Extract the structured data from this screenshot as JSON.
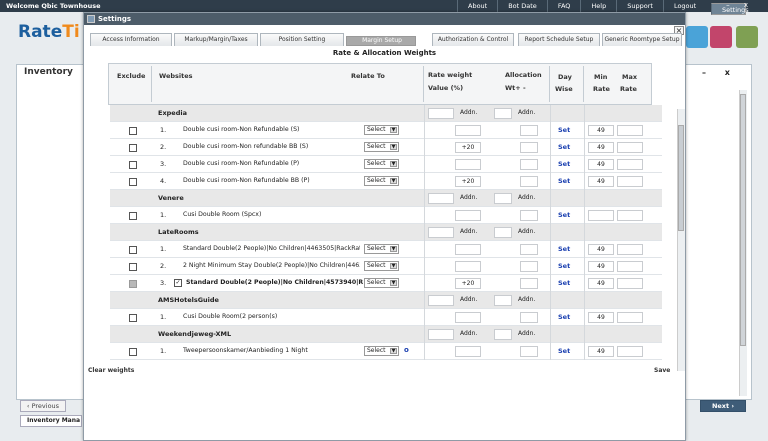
{
  "topbar": {
    "welcome": "Welcome Qbic Townhouse",
    "nav": [
      "About",
      "Settings",
      "Bot Date",
      "FAQ",
      "Help",
      "Support",
      "Logout"
    ],
    "win": "– x"
  },
  "logo": {
    "a": "Rate",
    "b": "Ti"
  },
  "bg": {
    "title": "Inventory",
    "prev": "‹ Previous",
    "next": "Next ›",
    "bottom_tab": "Inventory Mana",
    "ctrl": "– x"
  },
  "dialog": {
    "title": "Settings",
    "close": "×",
    "tabs": [
      "Access Information",
      "Markup/Margin/Taxes",
      "Position Setting",
      "Margin Setup",
      "Authorization & Control",
      "Report Schedule Setup",
      "Generic Roomtype Setup"
    ],
    "active_tab": 3,
    "subtitle": "Rate & Allocation Weights",
    "headers": {
      "exclude": "Exclude",
      "websites": "Websites",
      "relate": "Relate To",
      "rw1": "Rate weight",
      "rw2": "Value (%)",
      "al1": "Allocation",
      "al2": "Wt+ -",
      "day1": "Day",
      "day2": "Wise",
      "min1": "Min",
      "min2": "Rate",
      "max1": "Max",
      "max2": "Rate"
    },
    "addn": "Addn.",
    "set": "Set",
    "select": "Select",
    "groups": [
      {
        "name": "Expedia",
        "rows": [
          {
            "n": "1.",
            "site": "Double cusi room-Non Refundable (S)",
            "rw": "",
            "min": "49"
          },
          {
            "n": "2.",
            "site": "Double cusi room-Non refundable BB (S)",
            "rw": "+20",
            "min": "49"
          },
          {
            "n": "3.",
            "site": "Double cusi room-Non Refundable (P)",
            "rw": "",
            "min": "49"
          },
          {
            "n": "4.",
            "site": "Double cusi room-Non Refundable BB (P)",
            "rw": "+20",
            "min": "49"
          }
        ]
      },
      {
        "name": "Venere",
        "rows": [
          {
            "n": "1.",
            "site": "Cusi Double Room (Spcx)",
            "rw": "",
            "min": "",
            "nosel": true
          }
        ]
      },
      {
        "name": "LateRooms",
        "rows": [
          {
            "n": "1.",
            "site": "Standard Double(2 People)|No Children|4463505|RackRate(...",
            "rw": "",
            "min": "49"
          },
          {
            "n": "2.",
            "site": "2 Night Minimum Stay Double(2 People)|No Children|446383...",
            "rw": "",
            "min": "49"
          },
          {
            "n": "3.",
            "site": "Standard Double(2 People)|No Children|4573940|Rac...",
            "rw": "+20",
            "min": "49",
            "disabled": true,
            "bold": true
          }
        ]
      },
      {
        "name": "AMSHotelsGuide",
        "rows": [
          {
            "n": "1.",
            "site": "Cusi Double Room(2 person(s)",
            "rw": "",
            "min": "49",
            "nosel": true
          }
        ]
      },
      {
        "name": "Weekendjeweg-XML",
        "rows": [
          {
            "n": "1.",
            "site": "Tweepersoonskamer/Aanbieding 1 Night",
            "rw": "",
            "min": "49",
            "o": true
          }
        ]
      }
    ],
    "o_marker": "o",
    "clear": "Clear weights",
    "save": "Save"
  },
  "colors": {
    "topbar": "#2f3d4a",
    "title": "#4d5c69",
    "link": "#1a3fb0",
    "accent": "#f08a1c"
  }
}
